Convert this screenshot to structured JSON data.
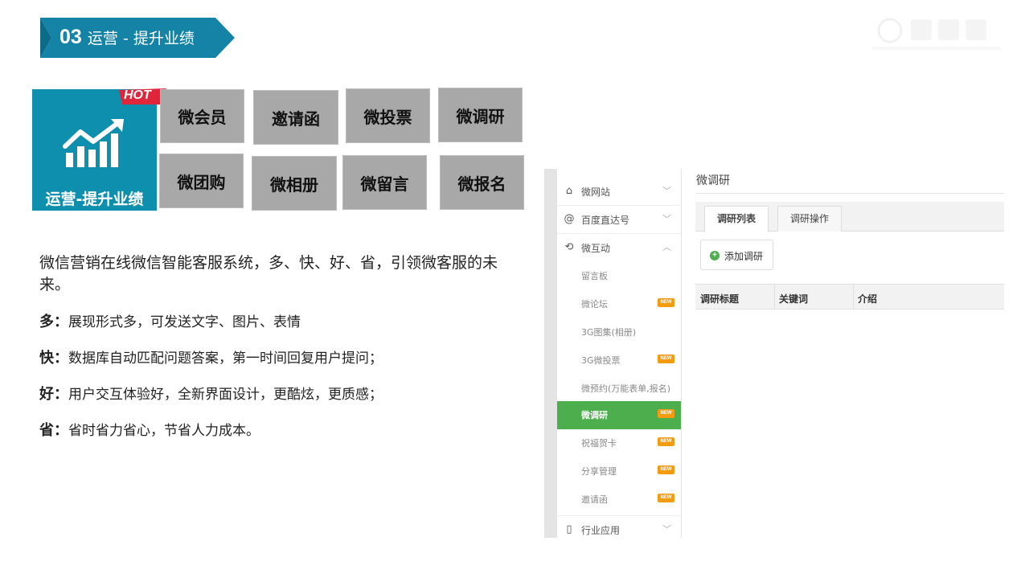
{
  "ribbon": {
    "number": "03",
    "title": "运营 - 提升业绩"
  },
  "feature": {
    "label": "运营-提升业绩",
    "hot": "HOT",
    "icon": "chart-up-icon"
  },
  "modules": [
    "微会员",
    "邀请函",
    "微投票",
    "微调研",
    "微团购",
    "微相册",
    "微留言",
    "微报名"
  ],
  "intro": "微信营销在线微信智能客服系统，多、快、好、省，引领微客服的未来。",
  "points": [
    {
      "key": "多：",
      "text": "展现形式多，可发送文字、图片、表情"
    },
    {
      "key": "快：",
      "text": "数据库自动匹配问题答案，第一时间回复用户提问；"
    },
    {
      "key": "好：",
      "text": "用户交互体验好，全新界面设计，更酷炫，更质感；"
    },
    {
      "key": "省：",
      "text": "省时省力省心，节省人力成本。"
    }
  ],
  "screenshot": {
    "sidebar": {
      "main_items": [
        {
          "label": "微网站",
          "icon": "home-icon"
        },
        {
          "label": "百度直达号",
          "icon": "at-icon"
        },
        {
          "label": "微互动",
          "icon": "interact-icon"
        }
      ],
      "sub_items": [
        {
          "label": "留言板",
          "new": false
        },
        {
          "label": "微论坛",
          "new": true
        },
        {
          "label": "3G图集(相册)",
          "new": false
        },
        {
          "label": "3G微投票",
          "new": true
        },
        {
          "label": "微预约(万能表单,报名)",
          "new": false
        },
        {
          "label": "微调研",
          "new": true,
          "active": true
        },
        {
          "label": "祝福贺卡",
          "new": true
        },
        {
          "label": "分享管理",
          "new": true
        },
        {
          "label": "邀请函",
          "new": true
        }
      ],
      "bottom_item": {
        "label": "行业应用",
        "icon": "phone-icon"
      },
      "new_badge": "NEW"
    },
    "content": {
      "title": "微调研",
      "tabs": [
        "调研列表",
        "调研操作"
      ],
      "add_button": "添加调研",
      "columns": [
        "调研标题",
        "关键词",
        "介绍"
      ]
    },
    "accent_green": "#4cae4c",
    "accent_orange": "#f39c12"
  },
  "colors": {
    "teal": "#0e8fae",
    "tile_gray": "#a8a8a8",
    "hot_red": "#e0263a"
  }
}
